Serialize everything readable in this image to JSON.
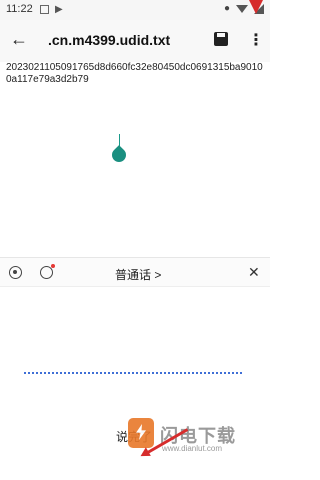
{
  "status_bar": {
    "time": "11:22"
  },
  "toolbar": {
    "title": ".cn.m4399.udid.txt"
  },
  "editor": {
    "text": "2023021105091765d8d660fc32e80450dc0691315ba90100a117e79a3d2b79"
  },
  "voice_input": {
    "language": "普通话 >",
    "done_label": "说完了"
  },
  "watermark": {
    "name": "闪电下载",
    "url": "www.dianlut.com"
  },
  "icons": {
    "back": "arrow-left",
    "save": "floppy-disk",
    "more": "vertical-dots",
    "settings": "settings-circle",
    "mode": "circle-dot",
    "close": "x"
  },
  "colors": {
    "accent": "#1a8f80",
    "wave": "#3f6fd6",
    "annotation": "#d62c2c"
  }
}
